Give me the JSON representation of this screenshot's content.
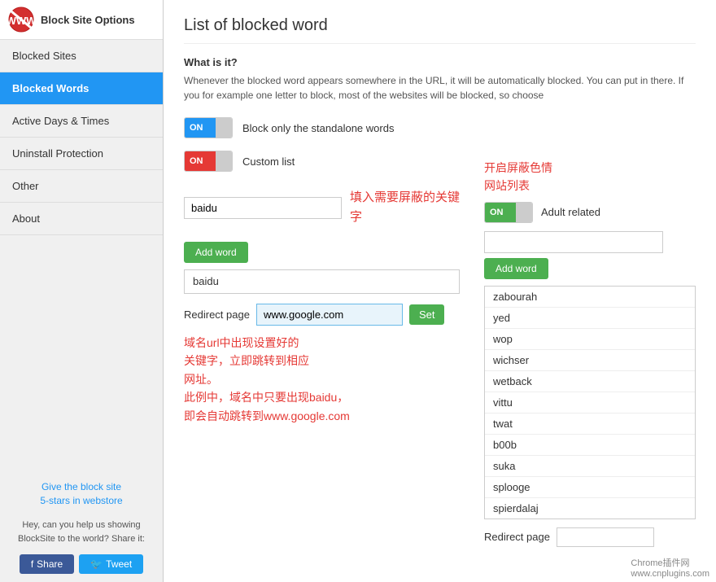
{
  "sidebar": {
    "title": "Block Site Options",
    "items": [
      {
        "id": "blocked-sites",
        "label": "Blocked Sites",
        "active": false
      },
      {
        "id": "blocked-words",
        "label": "Blocked Words",
        "active": true
      },
      {
        "id": "active-days-times",
        "label": "Active Days & Times",
        "active": false
      },
      {
        "id": "uninstall-protection",
        "label": "Uninstall Protection",
        "active": false
      },
      {
        "id": "other",
        "label": "Other",
        "active": false
      },
      {
        "id": "about",
        "label": "About",
        "active": false
      }
    ],
    "promo_text": "Give the block site\n5-stars in webstore",
    "share_text": "Hey, can you help us showing BlockSite to the world? Share it:",
    "btn_share": "Share",
    "btn_tweet": "Tweet"
  },
  "main": {
    "page_title": "List of blocked word",
    "what_is_it_label": "What is it?",
    "description": "Whenever the blocked word appears somewhere in the URL, it will be automatically blocked. You can put in there. If you for example one letter to block, most of the websites will be blocked, so choose",
    "toggle_standalone": {
      "on_label": "ON",
      "description": "Block only the standalone words"
    },
    "custom_list": {
      "on_label": "ON",
      "label": "Custom list"
    },
    "word_input_placeholder": "baidu",
    "word_input_value": "baidu",
    "btn_add_word": "Add word",
    "blocked_word_entry": "baidu",
    "redirect_label": "Redirect page",
    "redirect_value": "www.google.com",
    "btn_set": "Set",
    "annotation1": "填入需要屏蔽的关键字",
    "annotation2": "域名url中出现设置好的\n关键字，立即跳转到相应\n网址。\n此例中，域名中只要出现baidu，\n即会自动跳转到www.google.com",
    "annotation_right": "开启屏蔽色情\n网站列表",
    "adult_toggle": {
      "on_label": "ON",
      "description": "Adult related"
    },
    "right_add_word_btn": "Add word",
    "right_words": [
      "zabourah",
      "yed",
      "wop",
      "wichser",
      "wetback",
      "vittu",
      "twat",
      "b00b",
      "suka",
      "splooge",
      "spierdalaj"
    ],
    "right_redirect_label": "Redirect page",
    "watermark": "Chrome插件网\nwww.cnplugins.com"
  }
}
